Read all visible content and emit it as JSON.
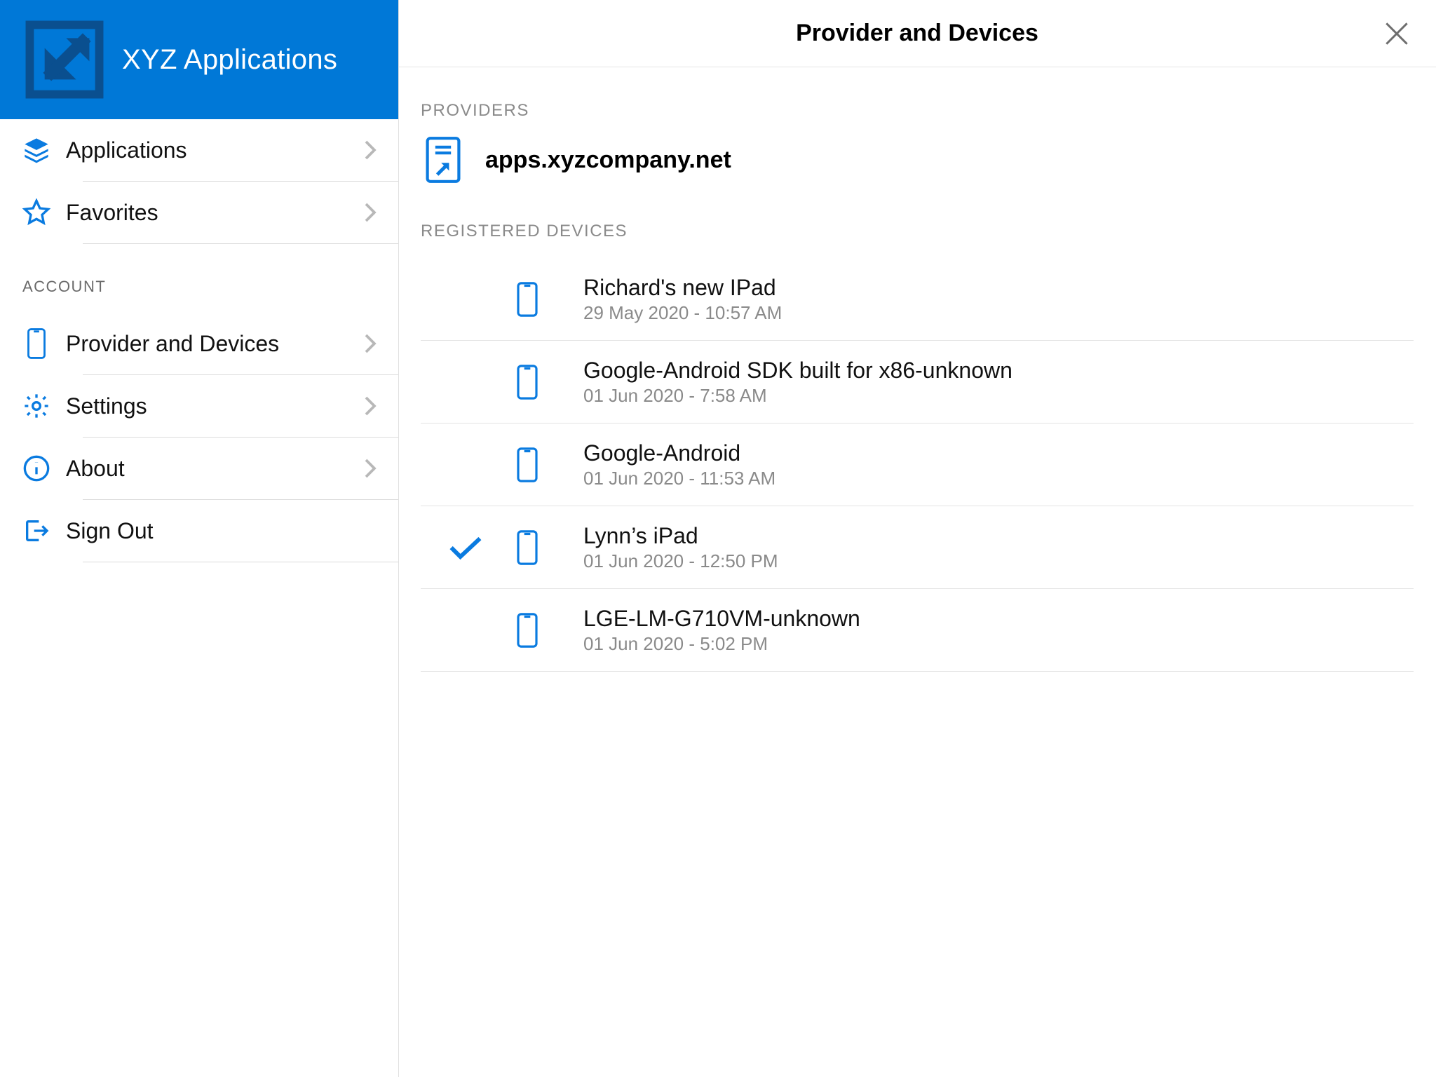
{
  "brand": {
    "title": "XYZ Applications"
  },
  "sidebar": {
    "primary": [
      {
        "label": "Applications"
      },
      {
        "label": "Favorites"
      }
    ],
    "account_label": "ACCOUNT",
    "account": [
      {
        "label": "Provider and Devices"
      },
      {
        "label": "Settings"
      },
      {
        "label": "About"
      },
      {
        "label": "Sign Out"
      }
    ]
  },
  "main": {
    "title": "Provider and Devices",
    "providers_label": "PROVIDERS",
    "provider_name": "apps.xyzcompany.net",
    "devices_label": "REGISTERED DEVICES",
    "devices": [
      {
        "name": "Richard's new IPad",
        "time": "29 May 2020 - 10:57 AM",
        "current": false
      },
      {
        "name": "Google-Android SDK built for x86-unknown",
        "time": "01 Jun 2020 - 7:58 AM",
        "current": false
      },
      {
        "name": "Google-Android",
        "time": "01 Jun 2020 - 11:53 AM",
        "current": false
      },
      {
        "name": "Lynn’s iPad",
        "time": "01 Jun 2020 - 12:50 PM",
        "current": true
      },
      {
        "name": "LGE-LM-G710VM-unknown",
        "time": "01 Jun 2020 - 5:02 PM",
        "current": false
      }
    ]
  }
}
